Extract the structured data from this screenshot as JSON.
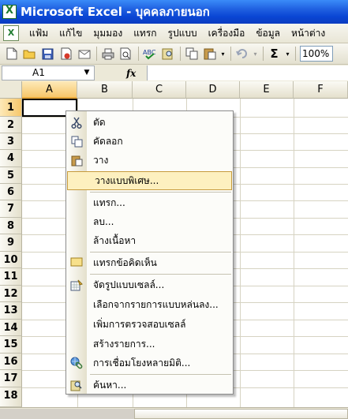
{
  "window": {
    "title": "Microsoft Excel - บุคคลภายนอก"
  },
  "menubar": {
    "items": [
      "แฟ้ม",
      "แก้ไข",
      "มุมมอง",
      "แทรก",
      "รูปแบบ",
      "เครื่องมือ",
      "ข้อมูล",
      "หน้าต่าง"
    ]
  },
  "toolbar": {
    "buttons": [
      "new-icon",
      "open-icon",
      "save-icon",
      "permission-icon",
      "email-icon",
      "print-icon",
      "print-preview-icon",
      "spelling-icon",
      "research-icon",
      "copy-icon",
      "paste-icon",
      "undo-icon",
      "autosum-icon"
    ],
    "zoom": "100%",
    "sum_glyph": "Σ",
    "fx_label": "fx"
  },
  "formula": {
    "namebox": "A1",
    "value": ""
  },
  "grid": {
    "columns": [
      "A",
      "B",
      "C",
      "D",
      "E",
      "F"
    ],
    "rows": [
      "1",
      "2",
      "3",
      "4",
      "5",
      "6",
      "7",
      "8",
      "9",
      "10",
      "11",
      "12",
      "13",
      "14",
      "15",
      "16",
      "17",
      "18"
    ],
    "active_cell": "A1"
  },
  "context_menu": {
    "items": [
      {
        "label": "ตัด",
        "icon": "cut-icon"
      },
      {
        "label": "คัดลอก",
        "icon": "copy-icon"
      },
      {
        "label": "วาง",
        "icon": "paste-icon"
      },
      {
        "label": "วางแบบพิเศษ...",
        "icon": "",
        "highlighted": true
      },
      {
        "label": "แทรก...",
        "icon": ""
      },
      {
        "label": "ลบ...",
        "icon": ""
      },
      {
        "label": "ล้างเนื้อหา",
        "icon": ""
      },
      {
        "label": "แทรกข้อคิดเห็น",
        "icon": "insert-comment-icon"
      },
      {
        "label": "จัดรูปแบบเซลล์...",
        "icon": "format-cells-icon"
      },
      {
        "label": "เลือกจากรายการแบบหล่นลง...",
        "icon": ""
      },
      {
        "label": "เพิ่มการตรวจสอบเซลล์",
        "icon": ""
      },
      {
        "label": "สร้างรายการ...",
        "icon": ""
      },
      {
        "label": "การเชื่อมโยงหลายมิติ...",
        "icon": "hyperlink-icon"
      },
      {
        "label": "ค้นหา...",
        "icon": "research-icon"
      }
    ]
  },
  "colors": {
    "titlebar": "#0a46d4",
    "highlight_bg": "#fdf0bf",
    "highlight_border": "#c69a3c",
    "active_header": "#f7c76a"
  }
}
